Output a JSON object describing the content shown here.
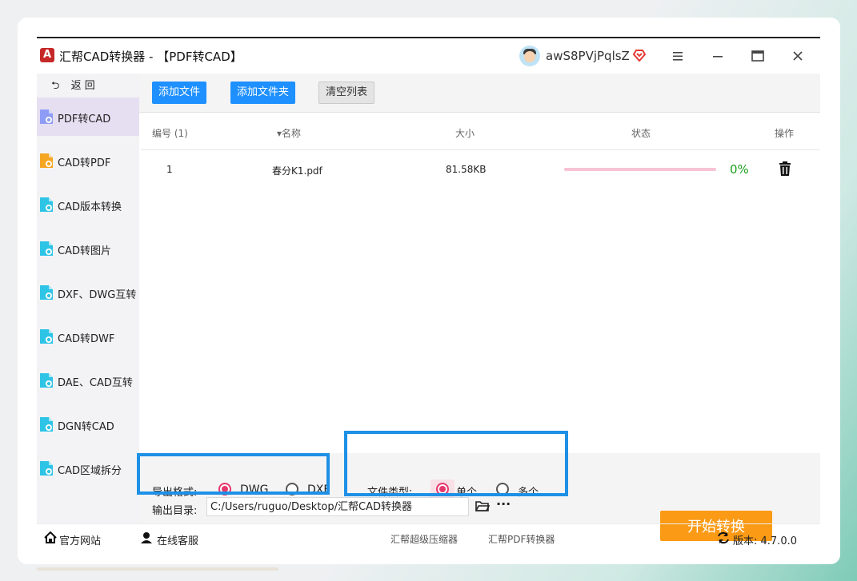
{
  "app": {
    "title": "汇帮CAD转换器 - 【PDF转CAD】",
    "username": "awS8PVjPqlsZ"
  },
  "sidebar": {
    "back_label": "返 回",
    "items": [
      {
        "label": "PDF转CAD",
        "active": true
      },
      {
        "label": "CAD转PDF",
        "active": false
      },
      {
        "label": "CAD版本转换",
        "active": false
      },
      {
        "label": "CAD转图片",
        "active": false
      },
      {
        "label": "DXF、DWG互转",
        "active": false
      },
      {
        "label": "CAD转DWF",
        "active": false
      },
      {
        "label": "DAE、CAD互转",
        "active": false
      },
      {
        "label": "DGN转CAD",
        "active": false
      },
      {
        "label": "CAD区域拆分",
        "active": false
      }
    ]
  },
  "toolbar": {
    "add_file": "添加文件",
    "add_folder": "添加文件夹",
    "clear_list": "清空列表"
  },
  "table": {
    "headers": {
      "index": "编号 (1)",
      "name": "▾名称",
      "size": "大小",
      "status": "状态",
      "action": "操作"
    },
    "rows": [
      {
        "index": "1",
        "name": "春分K1.pdf",
        "size": "81.58KB",
        "progress": 0,
        "progress_text": "0%"
      }
    ]
  },
  "options": {
    "format_label": "导出格式:",
    "format_options": [
      "DWG",
      "DXF"
    ],
    "format_selected": "DWG",
    "filetype_label": "文件类型:",
    "filetype_options": [
      "单个",
      "多个"
    ],
    "filetype_selected": "单个",
    "output_label": "输出目录:",
    "output_path": "C:/Users/ruguo/Desktop/汇帮CAD转换器",
    "more": "···"
  },
  "start_button": "开始转换",
  "footer": {
    "website": "官方网站",
    "support": "在线客服",
    "link1": "汇帮超级压缩器",
    "link2": "汇帮PDF转换器",
    "version": "版本:  4.7.0.0"
  },
  "colors": {
    "accent_blue": "#1e90ff",
    "start_orange": "#fb9a14",
    "radio_pink": "#e5386c",
    "highlight_blue": "#1e90e6",
    "progress_pink": "#f7c3d5",
    "percent_green": "#1b9e1b"
  }
}
